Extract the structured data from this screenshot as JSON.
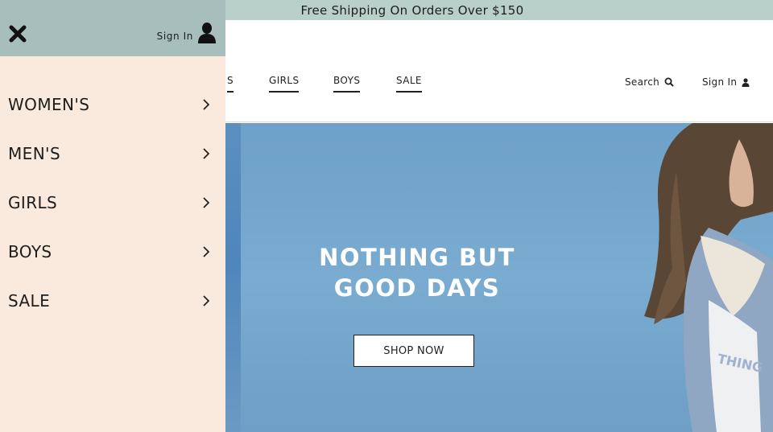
{
  "promo": {
    "text": "Free Shipping On Orders Over $150"
  },
  "header": {
    "nav": [
      {
        "label": "S"
      },
      {
        "label": "GIRLS"
      },
      {
        "label": "BOYS"
      },
      {
        "label": "SALE"
      }
    ],
    "search_label": "Search",
    "signin_label": "Sign In"
  },
  "hero": {
    "title_line1": "NOTHING BUT",
    "title_line2": "GOOD DAYS",
    "cta_label": "SHOP NOW"
  },
  "drawer": {
    "signin_label": "Sign In",
    "items": [
      {
        "label": "WOMEN'S"
      },
      {
        "label": "MEN'S"
      },
      {
        "label": "GIRLS"
      },
      {
        "label": "BOYS"
      },
      {
        "label": "SALE"
      }
    ]
  },
  "icons": {
    "close": "close-icon",
    "user": "user-icon",
    "search": "search-icon",
    "chevron": "chevron-right-icon"
  },
  "colors": {
    "promo_bg": "#b9cfc9",
    "drawer_bg": "#faeade",
    "drawer_header_bg": "#a7bebd",
    "hero_sky": "#78a6c9"
  }
}
